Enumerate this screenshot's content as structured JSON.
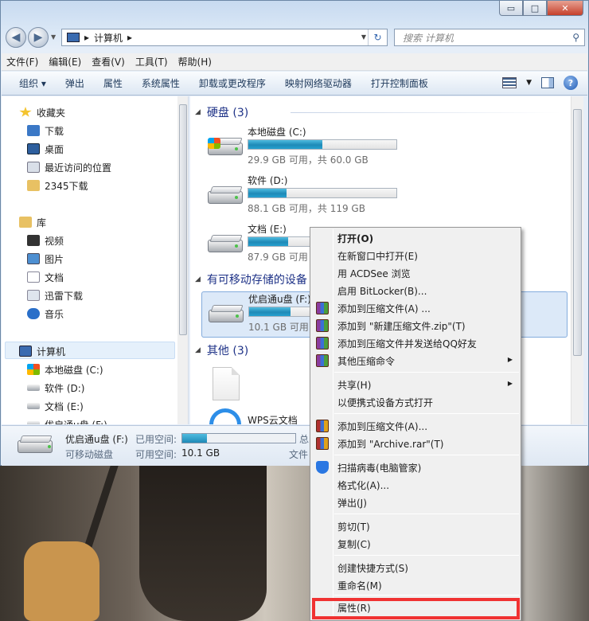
{
  "window": {
    "caption_buttons": {
      "minimize": "▭",
      "maximize": "□",
      "close": "✕"
    },
    "address": {
      "path": [
        "计算机"
      ],
      "separator": "▸"
    },
    "search": {
      "placeholder": "搜索 计算机"
    }
  },
  "menubar": [
    "文件(F)",
    "编辑(E)",
    "查看(V)",
    "工具(T)",
    "帮助(H)"
  ],
  "commandbar": [
    "组织 ▾",
    "弹出",
    "属性",
    "系统属性",
    "卸载或更改程序",
    "映射网络驱动器",
    "打开控制面板"
  ],
  "nav": {
    "favorites": {
      "label": "收藏夹",
      "items": [
        "下载",
        "桌面",
        "最近访问的位置",
        "2345下载"
      ]
    },
    "libraries": {
      "label": "库",
      "items": [
        "视频",
        "图片",
        "文档",
        "迅雷下载",
        "音乐"
      ]
    },
    "computer": {
      "label": "计算机",
      "items": [
        "本地磁盘 (C:)",
        "软件 (D:)",
        "文档 (E:)",
        "优启通u盘 (F:)"
      ]
    }
  },
  "content": {
    "group_hdd": "硬盘 (3)",
    "group_removable": "有可移动存储的设备",
    "group_other": "其他 (3)",
    "drives": [
      {
        "name": "本地磁盘 (C:)",
        "free": "29.9 GB 可用，共 60.0 GB",
        "used_fraction": 0.5
      },
      {
        "name": "软件 (D:)",
        "free": "88.1 GB 可用，共 119 GB",
        "used_fraction": 0.26
      },
      {
        "name": "文档 (E:)",
        "free": "87.9 GB 可用",
        "used_fraction": 0.27
      },
      {
        "name": "优启通u盘 (F:)",
        "free": "10.1 GB 可用",
        "used_fraction": 0.28
      }
    ],
    "other_items": [
      "WPS云文档"
    ]
  },
  "details": {
    "name": "优启通u盘 (F:)",
    "type": "可移动磁盘",
    "used_label": "已用空间:",
    "free_label": "可用空间:",
    "free_value": "10.1 GB",
    "total_label": "总",
    "fs_label": "文件",
    "used_fraction": 0.22
  },
  "context_menu": {
    "items": [
      {
        "label": "打开(O)",
        "bold": true
      },
      {
        "label": "在新窗口中打开(E)"
      },
      {
        "label": "用 ACDSee 浏览"
      },
      {
        "label": "启用 BitLocker(B)..."
      },
      {
        "label": "添加到压缩文件(A) ...",
        "icon": "winrar-icon"
      },
      {
        "label": "添加到 \"新建压缩文件.zip\"(T)",
        "icon": "winrar-icon"
      },
      {
        "label": "添加到压缩文件并发送给QQ好友",
        "icon": "winrar-icon"
      },
      {
        "label": "其他压缩命令",
        "icon": "winrar-icon",
        "submenu": true
      },
      {
        "label": "共享(H)",
        "submenu": true
      },
      {
        "label": "以便携式设备方式打开"
      },
      {
        "label": "添加到压缩文件(A)...",
        "icon": "rar-icon"
      },
      {
        "label": "添加到 \"Archive.rar\"(T)",
        "icon": "rar-icon"
      },
      {
        "label": "扫描病毒(电脑管家)",
        "icon": "shield-icon"
      },
      {
        "label": "格式化(A)..."
      },
      {
        "label": "弹出(J)"
      },
      {
        "label": "剪切(T)"
      },
      {
        "label": "复制(C)"
      },
      {
        "label": "创建快捷方式(S)"
      },
      {
        "label": "重命名(M)"
      },
      {
        "label": "属性(R)",
        "highlighted": true
      }
    ],
    "highlight_color": "#f03232"
  }
}
